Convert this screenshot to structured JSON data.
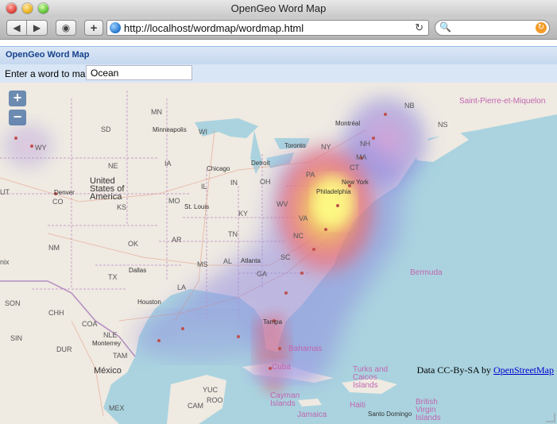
{
  "window": {
    "title": "OpenGeo Word Map"
  },
  "toolbar": {
    "back_icon": "◀",
    "forward_icon": "▶",
    "stop_icon": "◉",
    "add_icon": "+",
    "url": "http://localhost/wordmap/wordmap.html",
    "reload_icon": "↻",
    "search_icon": "🔍",
    "search_go_icon": "↻",
    "search_value": ""
  },
  "app": {
    "title": "OpenGeo Word Map",
    "input_label": "Enter a word to map:",
    "word_value": "Ocean"
  },
  "map": {
    "zoom_in": "+",
    "zoom_out": "−",
    "attribution_prefix": "Data CC-By-SA by ",
    "attribution_link": "OpenStreetMap",
    "labels": {
      "nb": "NB",
      "saint_pierre": "Saint-Pierre-et-Miquelon",
      "ns": "NS",
      "mn": "MN",
      "minneapolis": "Minneapolis",
      "wi": "WI",
      "sd": "SD",
      "ne": "NE",
      "ia": "IA",
      "chicago": "Chicago",
      "wy": "WY",
      "denver": "Denver",
      "co": "CO",
      "united_states": "United States of America",
      "ks": "KS",
      "mo": "MO",
      "il": "IL",
      "st_louis": "St. Louis",
      "in": "IN",
      "oh": "OH",
      "toronto": "Toronto",
      "detroit": "Detroit",
      "ny": "NY",
      "montreal": "Montréal",
      "nh": "NH",
      "ma": "MA",
      "ct": "CT",
      "pa": "PA",
      "philadelphia": "Philadelphia",
      "new_york": "New York",
      "wv": "WV",
      "va": "VA",
      "ky": "KY",
      "tn": "TN",
      "nc": "NC",
      "ok": "OK",
      "ar": "AR",
      "nm": "NM",
      "dallas": "Dallas",
      "tx": "TX",
      "ms": "MS",
      "al": "AL",
      "atlanta": "Atlanta",
      "sc": "SC",
      "ga": "GA",
      "la": "LA",
      "houston": "Houston",
      "son": "SON",
      "chh": "CHH",
      "coa": "COA",
      "nle": "NLE",
      "monterrey": "Monterrey",
      "sin": "SIN",
      "dur": "DUR",
      "tam": "TAM",
      "mexico": "México",
      "tampa": "Tampa",
      "bahamas": "Bahamas",
      "cuba": "Cuba",
      "bermuda": "Bermuda",
      "turks": "Turks and Caicos Islands",
      "yuc": "YUC",
      "roo": "ROO",
      "cam": "CAM",
      "cayman": "Cayman Islands",
      "jamaica": "Jamaica",
      "haiti": "Haiti",
      "santo_domingo": "Santo Domingo",
      "bvi": "British Virgin Islands",
      "mex": "MEX",
      "nix": "nix",
      "ut": "UT"
    }
  }
}
